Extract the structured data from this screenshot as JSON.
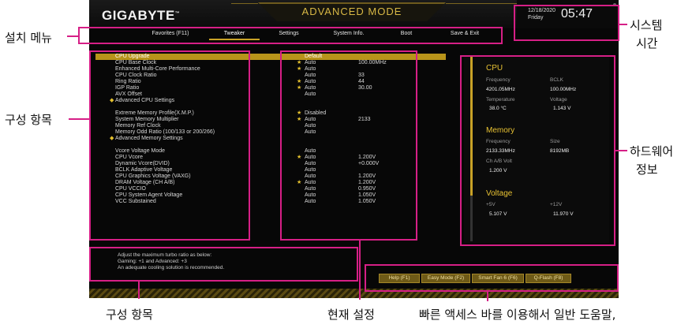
{
  "header": {
    "brand": "GIGABYTE",
    "brand_tm": "™",
    "mode": "ADVANCED MODE",
    "date_line1": "12/18/2020",
    "date_line2": "Friday",
    "time": "05:47"
  },
  "menu": {
    "tabs": [
      {
        "label": "Favorites (F11)"
      },
      {
        "label": "Tweaker"
      },
      {
        "label": "Settings"
      },
      {
        "label": "System Info."
      },
      {
        "label": "Boot"
      },
      {
        "label": "Save & Exit"
      }
    ]
  },
  "settings": {
    "rows": [
      {
        "label": "CPU Upgrade",
        "value": "Default"
      },
      {
        "label": "CPU Base Clock",
        "value": "Auto",
        "num": "100.00MHz"
      },
      {
        "label": "Enhanced Multi-Core Performance",
        "value": "Auto"
      },
      {
        "label": "CPU Clock Ratio",
        "value": "Auto",
        "num": "33"
      },
      {
        "label": "Ring Ratio",
        "value": "Auto",
        "num": "44"
      },
      {
        "label": "IGP Ratio",
        "value": "Auto",
        "num": "30.00"
      },
      {
        "label": "AVX Offset",
        "value": "Auto"
      },
      {
        "label": "Advanced CPU Settings"
      },
      {
        "label": "Extreme Memory Profile(X.M.P.)",
        "value": "Disabled"
      },
      {
        "label": "System Memory Multiplier",
        "value": "Auto",
        "num": "2133"
      },
      {
        "label": "Memory Ref Clock",
        "value": "Auto"
      },
      {
        "label": "Memory Odd Ratio (100/133 or 200/266)",
        "value": "Auto"
      },
      {
        "label": "Advanced Memory Settings"
      },
      {
        "label": "Vcore Voltage Mode",
        "value": "Auto"
      },
      {
        "label": "CPU Vcore",
        "value": "Auto",
        "num": "1.200V"
      },
      {
        "label": "Dynamic Vcore(DVID)",
        "value": "Auto",
        "num": "+0.000V"
      },
      {
        "label": "BCLK Adaptive Voltage",
        "value": "Auto"
      },
      {
        "label": "CPU Graphics Voltage (VAXG)",
        "value": "Auto",
        "num": "1.200V"
      },
      {
        "label": "DRAM Voltage    (CH A/B)",
        "value": "Auto",
        "num": "1.200V"
      },
      {
        "label": "CPU VCCIO",
        "value": "Auto",
        "num": "0.950V"
      },
      {
        "label": "CPU System Agent Voltage",
        "value": "Auto",
        "num": "1.050V"
      },
      {
        "label": "VCC Substained",
        "value": "Auto",
        "num": "1.050V"
      }
    ]
  },
  "hw": {
    "cpu_title": "CPU",
    "cpu_freq_label": "Frequency",
    "cpu_freq": "4201.05MHz",
    "bclk_label": "BCLK",
    "bclk": "100.00MHz",
    "temp_label": "Temperature",
    "temp": "38.0 °C",
    "volt_label": "Voltage",
    "volt": "1.143 V",
    "mem_title": "Memory",
    "mem_freq_label": "Frequency",
    "mem_freq": "2133.33MHz",
    "size_label": "Size",
    "size": "8192MB",
    "chab_label": "Ch A/B Volt",
    "chab": "1.200 V",
    "vtitle": "Voltage",
    "p5_label": "+5V",
    "p5": "5.107 V",
    "p12_label": "+12V",
    "p12": "11.970 V"
  },
  "help": {
    "line1": "Adjust the maximum turbo ratio as below:",
    "line2": "Gaming: +1 and Advanced: +3",
    "line3": "An adequate cooling solution is recommended."
  },
  "quick": {
    "help": "Help (F1)",
    "easy": "Easy Mode (F2)",
    "fan": "Smart Fan 6 (F6)",
    "qflash": "Q-Flash (F8)"
  },
  "annotations": {
    "setup_menu": "설치 메뉴",
    "config_items_left": "구성 항목",
    "config_items_bottom": "구성 항목",
    "current_settings": "현재 설정",
    "quick_access": "빠른 액세스 바를 이용해서 일반 도움말,",
    "system_time_1": "시스템",
    "system_time_2": "시간",
    "hw_info_1": "하드웨어",
    "hw_info_2": "정보"
  }
}
